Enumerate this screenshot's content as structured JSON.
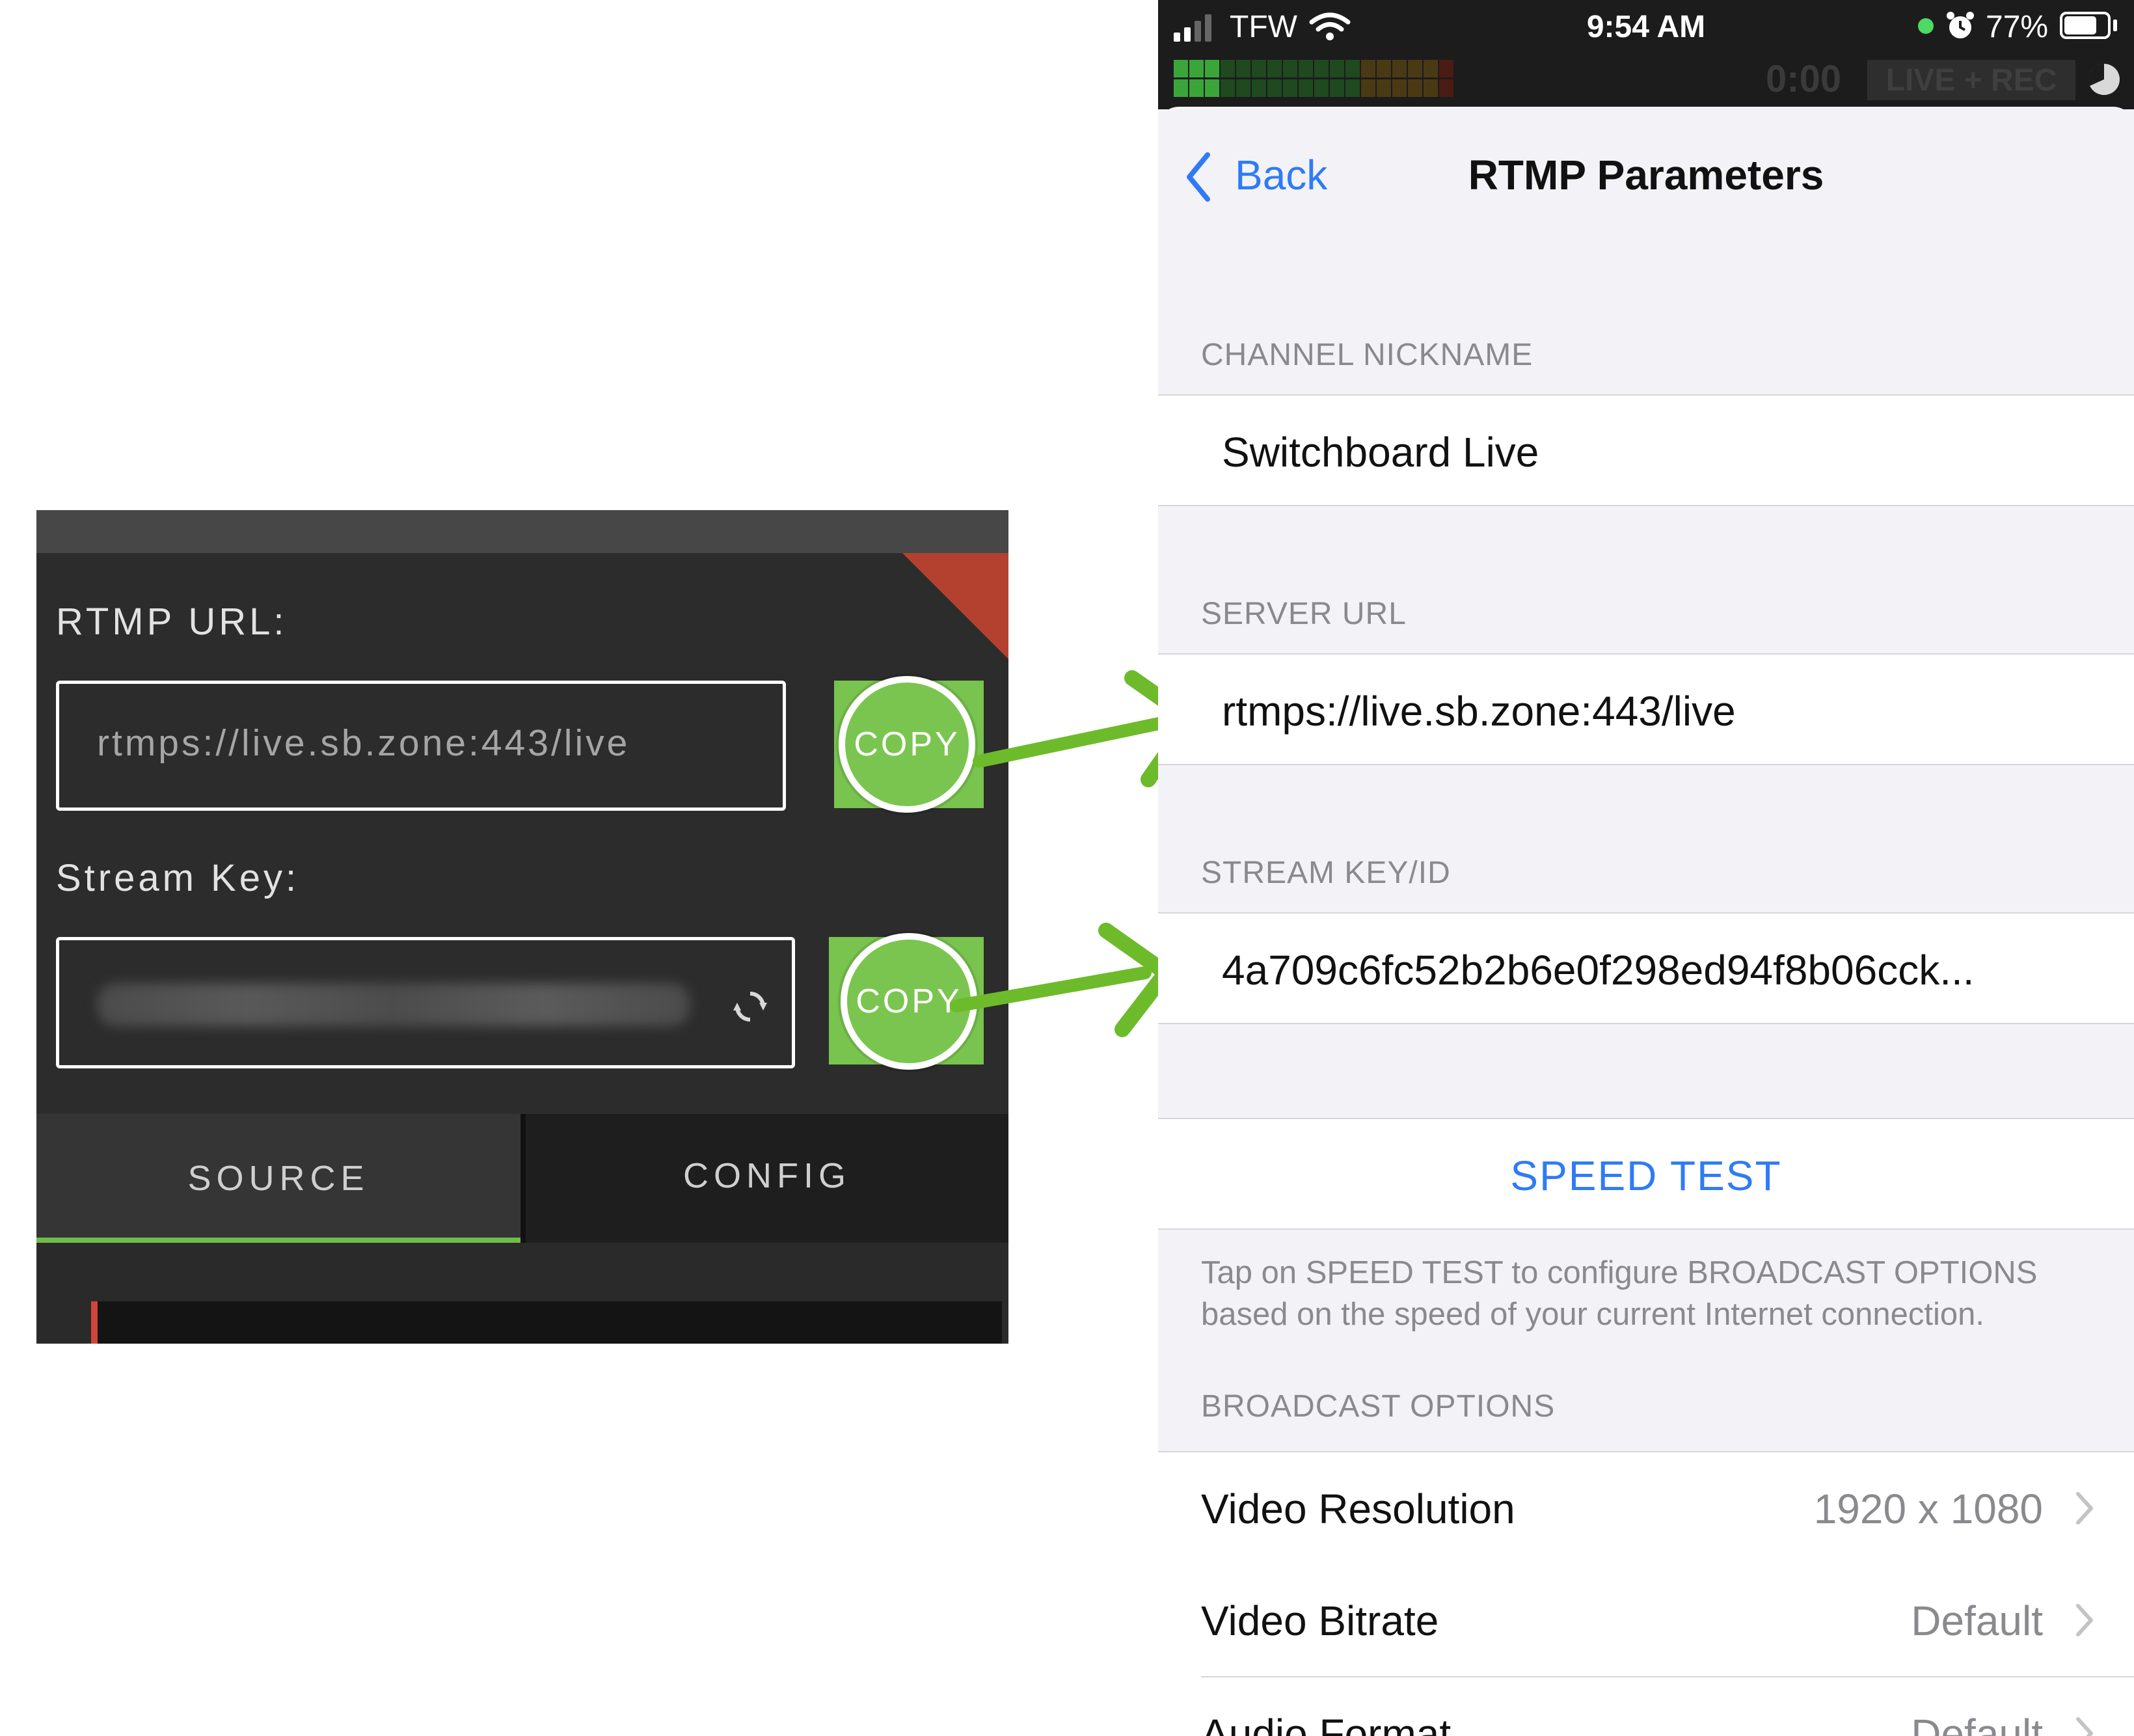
{
  "web_panel": {
    "rtmp_url_label": "RTMP URL:",
    "rtmp_url_value": "rtmps://live.sb.zone:443/live",
    "stream_key_label": "Stream Key:",
    "copy_label": "COPY",
    "tabs": [
      {
        "label": "SOURCE",
        "active": true
      },
      {
        "label": "CONFIG",
        "active": false
      }
    ],
    "accent_color": "#79c34f",
    "corner_color": "#b4412f"
  },
  "status_bar": {
    "carrier": "TFW",
    "time": "9:54 AM",
    "battery": "77%",
    "timer": "0:00",
    "live_rec": "LIVE + REC",
    "battery_level": 0.77
  },
  "nav": {
    "back_label": "Back",
    "title": "RTMP Parameters"
  },
  "sections": {
    "channel_nickname_header": "CHANNEL NICKNAME",
    "channel_nickname_value": "Switchboard Live",
    "server_url_header": "SERVER URL",
    "server_url_value": "rtmps://live.sb.zone:443/live",
    "stream_key_header": "STREAM KEY/ID",
    "stream_key_value": "4a709c6fc52b2b6e0f298ed94f8b06cck...",
    "speed_test_label": "SPEED TEST",
    "speed_test_note": "Tap on SPEED TEST to configure BROADCAST OPTIONS based on the speed of your current Internet connection.",
    "broadcast_options_header": "BROADCAST OPTIONS"
  },
  "broadcast_options": [
    {
      "label": "Video Resolution",
      "value": "1920 x 1080"
    },
    {
      "label": "Video Bitrate",
      "value": "Default"
    },
    {
      "label": "Audio Format",
      "value": "Default"
    }
  ],
  "colors": {
    "ios_blue": "#2f7bf5",
    "arrow_green": "#6dbb2a"
  }
}
